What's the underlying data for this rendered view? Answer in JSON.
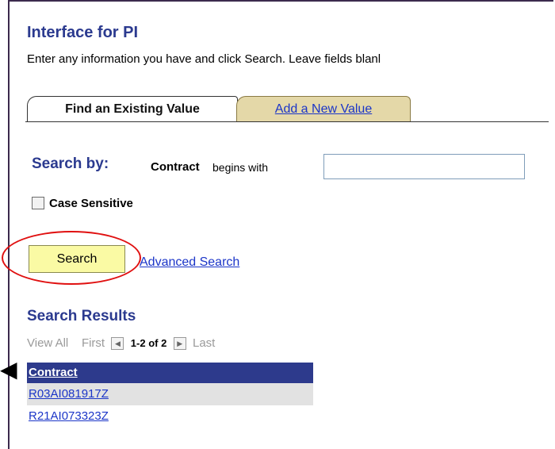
{
  "page": {
    "title": "Interface for PI",
    "instructions": "Enter any information you have and click Search. Leave fields blanl"
  },
  "tabs": [
    {
      "label": "Find an Existing Value",
      "active": true
    },
    {
      "label": "Add a New Value",
      "active": false
    }
  ],
  "search": {
    "heading": "Search by:",
    "field_label": "Contract",
    "operator": "begins with",
    "value": "",
    "case_sensitive_label": "Case Sensitive",
    "case_sensitive_checked": false,
    "search_button": "Search",
    "advanced_link": "Advanced Search"
  },
  "results": {
    "heading": "Search Results",
    "view_all": "View All",
    "first": "First",
    "count": "1-2 of 2",
    "last": "Last",
    "column_header": "Contract",
    "rows": [
      "R03AI081917Z",
      "R21AI073323Z"
    ]
  },
  "colors": {
    "heading": "#2b3a8f",
    "link": "#1b35c8",
    "table_header_bg": "#2d3a8c",
    "search_button_bg": "#fafaa4",
    "highlight": "#e01010",
    "inactive_tab_bg": "#e4d8a8"
  }
}
